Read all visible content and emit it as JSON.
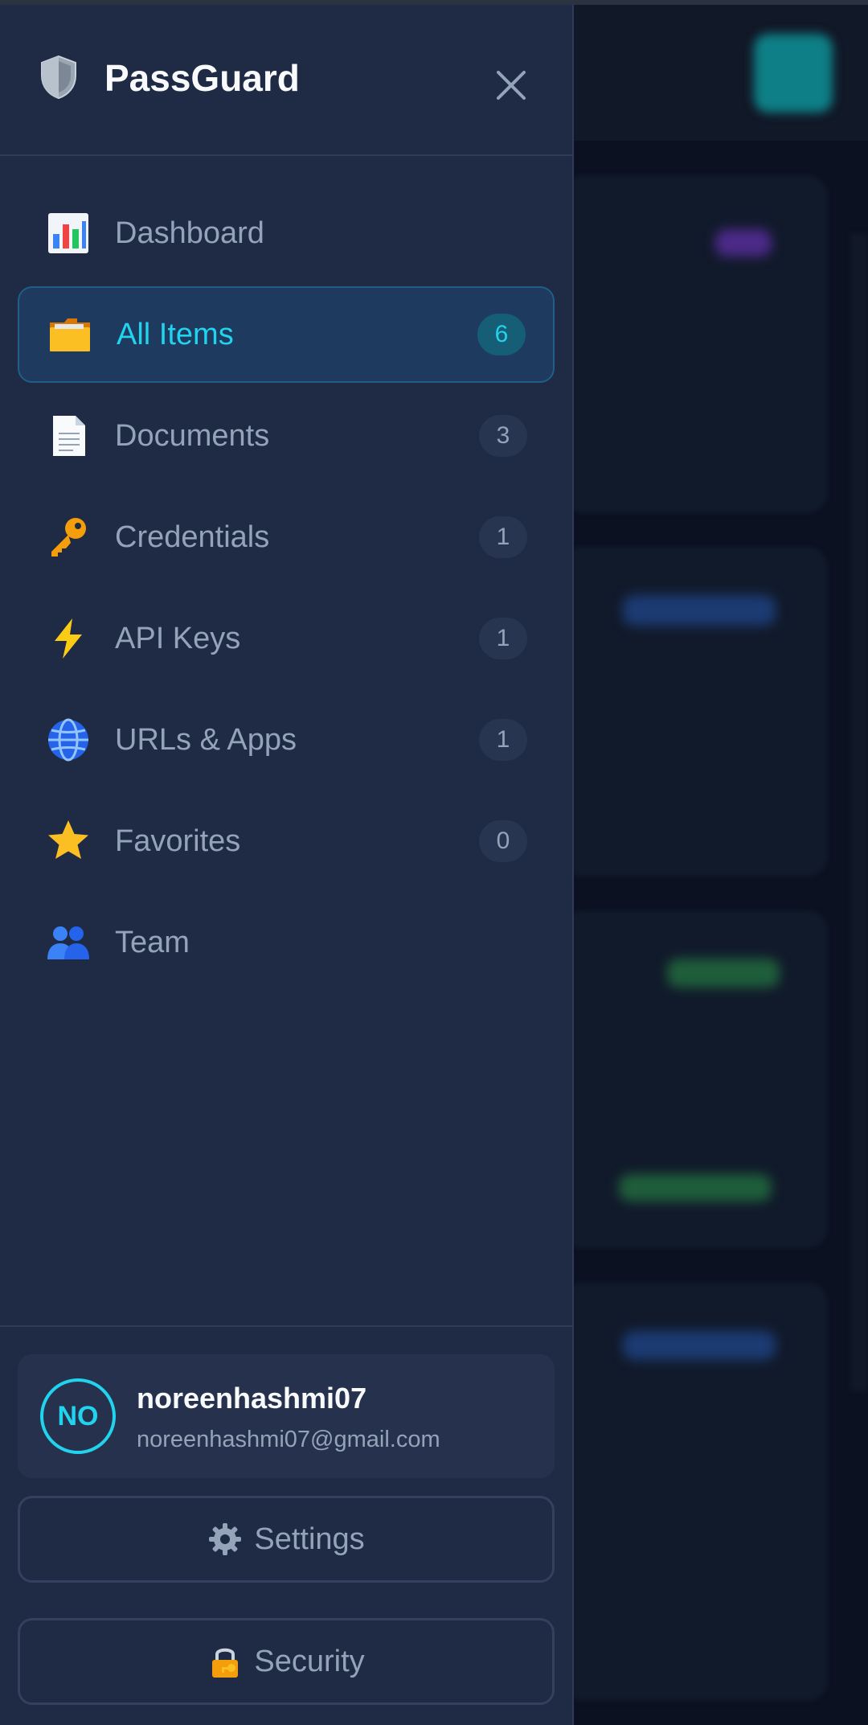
{
  "app": {
    "title": "PassGuard"
  },
  "sidebar": {
    "items": [
      {
        "label": "Dashboard",
        "icon": "bar-chart-icon",
        "badge": null,
        "active": false
      },
      {
        "label": "All Items",
        "icon": "folder-icon",
        "badge": "6",
        "active": true
      },
      {
        "label": "Documents",
        "icon": "document-icon",
        "badge": "3",
        "active": false
      },
      {
        "label": "Credentials",
        "icon": "key-icon",
        "badge": "1",
        "active": false
      },
      {
        "label": "API Keys",
        "icon": "lightning-icon",
        "badge": "1",
        "active": false
      },
      {
        "label": "URLs & Apps",
        "icon": "globe-icon",
        "badge": "1",
        "active": false
      },
      {
        "label": "Favorites",
        "icon": "star-icon",
        "badge": "0",
        "active": false
      },
      {
        "label": "Team",
        "icon": "users-icon",
        "badge": null,
        "active": false
      }
    ]
  },
  "user": {
    "initials": "NO",
    "name": "noreenhashmi07",
    "email": "noreenhashmi07@gmail.com"
  },
  "footer": {
    "settings_label": "Settings",
    "security_label": "Security"
  },
  "colors": {
    "accent": "#22d3ee",
    "drawer_bg": "#1f2a44",
    "active_bg": "#1e3a5f"
  }
}
